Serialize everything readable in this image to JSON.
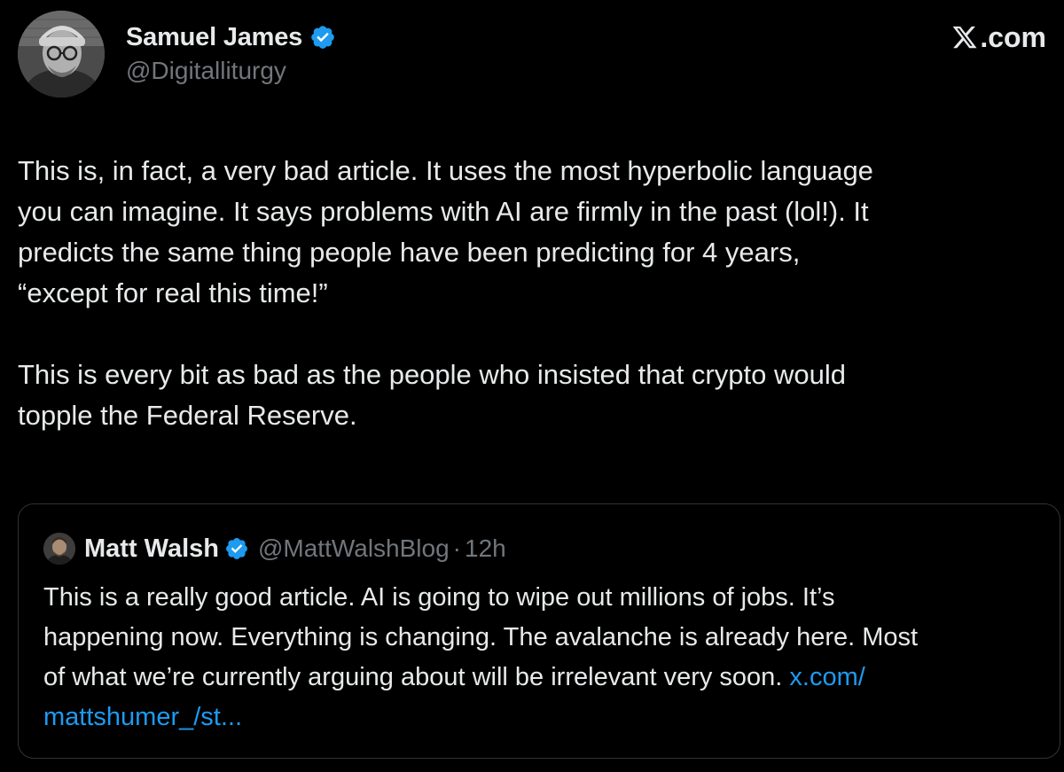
{
  "author": {
    "display_name": "Samuel James",
    "handle": "@Digitalliturgy",
    "verified": true
  },
  "brand": {
    "label": ".com",
    "icon": "x-logo-icon"
  },
  "tweet": {
    "paragraph1_line1": "This is, in fact, a very bad article. It uses the most hyperbolic language",
    "paragraph1_line2": "you can imagine. It says problems with AI are firmly in the past (lol!). It",
    "paragraph1_line3": "predicts the same thing people have been predicting for 4 years,",
    "paragraph1_line4": "“except for real this time!”",
    "paragraph2_line1": "This is every bit as bad as the people who insisted that crypto would",
    "paragraph2_line2": "topple the Federal Reserve."
  },
  "quote": {
    "display_name": "Matt Walsh",
    "handle": "@MattWalshBlog",
    "separator": "·",
    "time": "12h",
    "verified": true,
    "line1": "This is a really good article. AI is going to wipe out millions of jobs. It’s",
    "line2": "happening now. Everything is changing. The avalanche is already here. Most",
    "line3": "of what we’re currently arguing about will be irrelevant very soon. ",
    "link_part1": "x.com/",
    "link_part2": "mattshumer_/st..."
  },
  "colors": {
    "background": "#000000",
    "text": "#e7e9ea",
    "muted": "#71767b",
    "link": "#1d9bf0",
    "verified_badge": "#1d9bf0",
    "border": "#2f3336"
  }
}
